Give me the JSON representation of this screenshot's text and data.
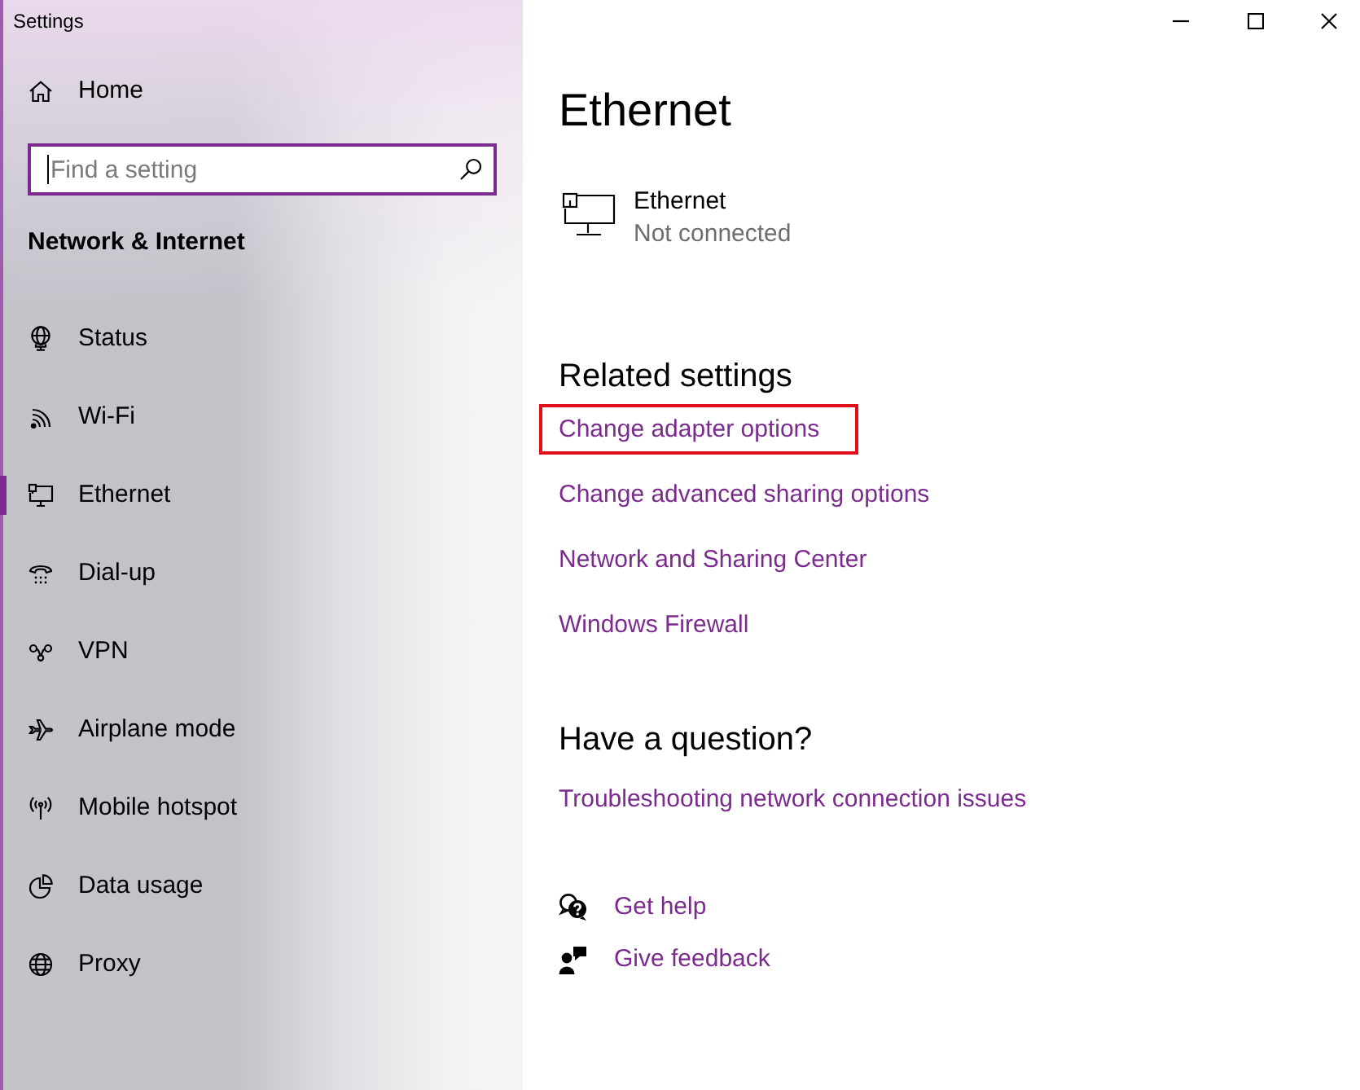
{
  "window": {
    "title": "Settings"
  },
  "sidebar": {
    "home": {
      "label": "Home"
    },
    "search": {
      "placeholder": "Find a setting",
      "focused": true
    },
    "section_title": "Network & Internet",
    "items": [
      {
        "label": "Status",
        "selected": false
      },
      {
        "label": "Wi-Fi",
        "selected": false
      },
      {
        "label": "Ethernet",
        "selected": true
      },
      {
        "label": "Dial-up",
        "selected": false
      },
      {
        "label": "VPN",
        "selected": false
      },
      {
        "label": "Airplane mode",
        "selected": false
      },
      {
        "label": "Mobile hotspot",
        "selected": false
      },
      {
        "label": "Data usage",
        "selected": false
      },
      {
        "label": "Proxy",
        "selected": false
      }
    ]
  },
  "content": {
    "title": "Ethernet",
    "adapter": {
      "name": "Ethernet",
      "status": "Not connected"
    },
    "related_settings": {
      "heading": "Related settings",
      "links": [
        {
          "label": "Change adapter options",
          "highlighted": true
        },
        {
          "label": "Change advanced sharing options",
          "highlighted": false
        },
        {
          "label": "Network and Sharing Center",
          "highlighted": false
        },
        {
          "label": "Windows Firewall",
          "highlighted": false
        }
      ]
    },
    "question": {
      "heading": "Have a question?",
      "links": [
        {
          "label": "Troubleshooting network connection issues"
        }
      ]
    },
    "help_links": [
      {
        "label": "Get help"
      },
      {
        "label": "Give feedback"
      }
    ]
  }
}
